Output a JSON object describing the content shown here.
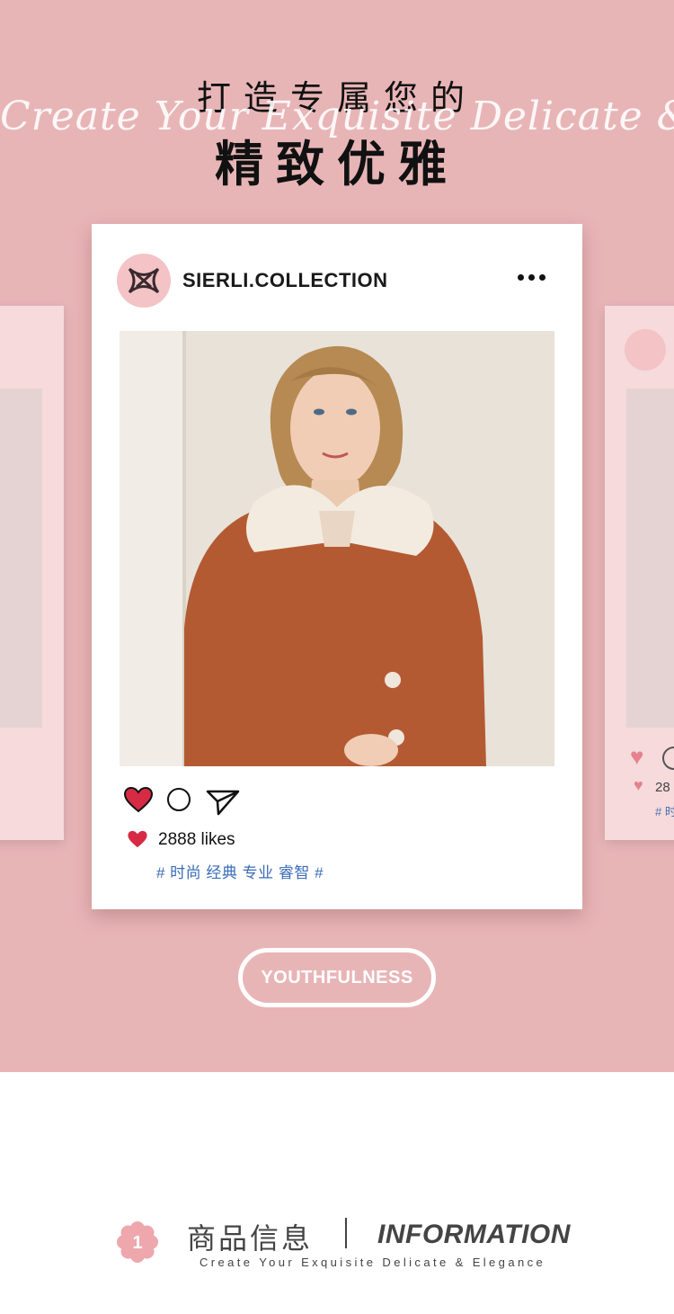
{
  "header": {
    "script_text": "Create Your Exquisite Delicate & Elegance",
    "title_line1": "打造专属您的",
    "title_line2": "精致优雅"
  },
  "post": {
    "username": "SIERLI.COLLECTION",
    "avatar_icon": "sierli-logo-icon",
    "likes": "2888 likes",
    "tags": "# 时尚 经典 专业 睿智 #",
    "side_likes": "28",
    "side_tags": "# 时"
  },
  "badge": {
    "label": "YOUTHFULNESS"
  },
  "section": {
    "number": "1",
    "title_cn": "商品信息",
    "title_en": "INFORMATION",
    "subtitle": "Create Your Exquisite Delicate & Elegance"
  },
  "colors": {
    "background_pink": "#e8b5b7",
    "card_pink": "#f6dadc",
    "heart_red": "#d62a45",
    "tag_blue": "#3b6cb7"
  }
}
